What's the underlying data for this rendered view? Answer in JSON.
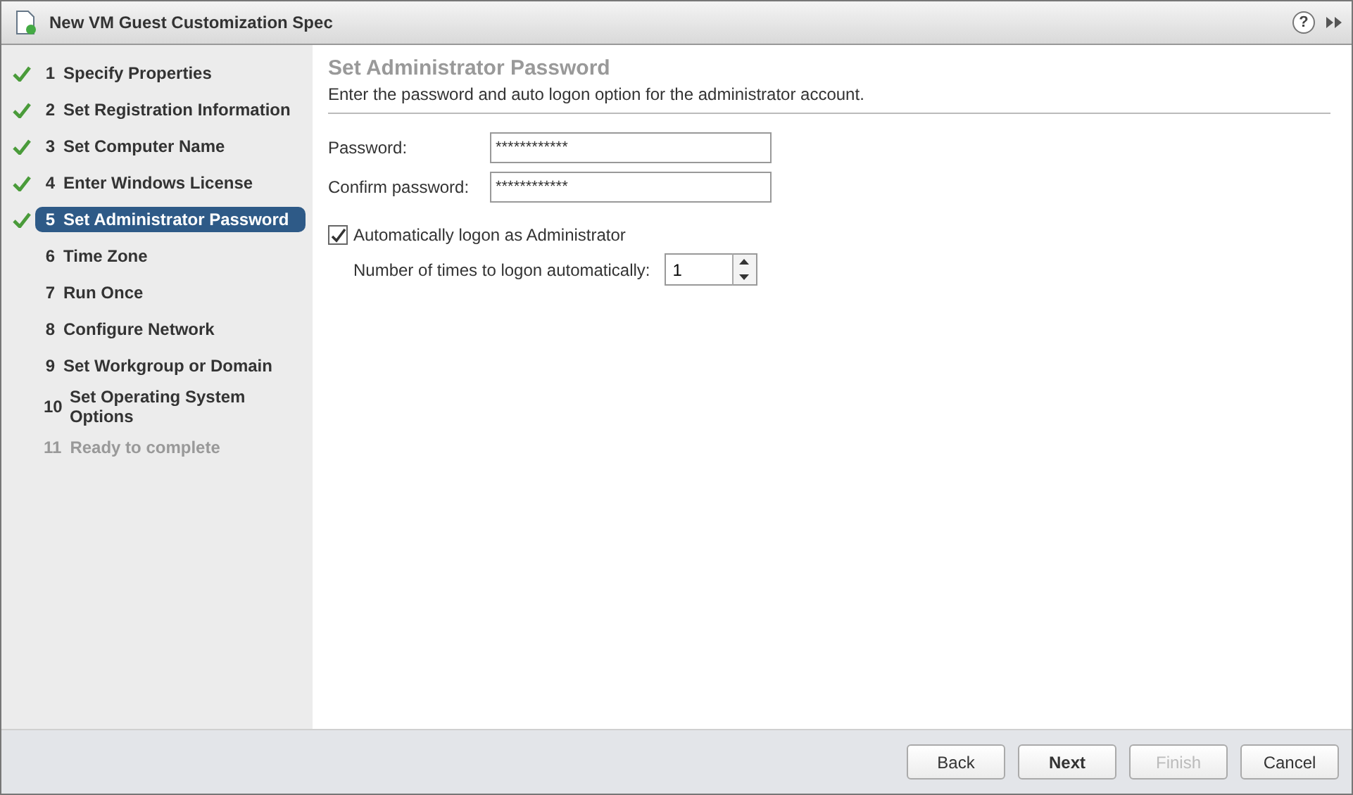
{
  "window": {
    "title": "New VM Guest Customization Spec",
    "help": "?"
  },
  "steps": [
    {
      "number": "1",
      "label": "Specify Properties",
      "done": true,
      "selected": false,
      "disabled": false
    },
    {
      "number": "2",
      "label": "Set Registration Information",
      "done": true,
      "selected": false,
      "disabled": false
    },
    {
      "number": "3",
      "label": "Set Computer Name",
      "done": true,
      "selected": false,
      "disabled": false
    },
    {
      "number": "4",
      "label": "Enter Windows License",
      "done": true,
      "selected": false,
      "disabled": false
    },
    {
      "number": "5",
      "label": "Set Administrator Password",
      "done": true,
      "selected": true,
      "disabled": false
    },
    {
      "number": "6",
      "label": "Time Zone",
      "done": false,
      "selected": false,
      "disabled": false
    },
    {
      "number": "7",
      "label": "Run Once",
      "done": false,
      "selected": false,
      "disabled": false
    },
    {
      "number": "8",
      "label": "Configure Network",
      "done": false,
      "selected": false,
      "disabled": false
    },
    {
      "number": "9",
      "label": "Set Workgroup or Domain",
      "done": false,
      "selected": false,
      "disabled": false
    },
    {
      "number": "10",
      "label": "Set Operating System Options",
      "done": false,
      "selected": false,
      "disabled": false
    },
    {
      "number": "11",
      "label": "Ready to complete",
      "done": false,
      "selected": false,
      "disabled": true
    }
  ],
  "page": {
    "title": "Set Administrator Password",
    "description": "Enter the password and auto logon option for the administrator account.",
    "fields": [
      {
        "label": "Password:",
        "value": "************"
      },
      {
        "label": "Confirm password:",
        "value": "************"
      }
    ],
    "auto_logon": {
      "label": "Automatically logon as Administrator",
      "checked": true
    },
    "logon_count": {
      "label": "Number of times to logon automatically:",
      "value": "1"
    }
  },
  "buttons": [
    {
      "label": "Back",
      "primary": false,
      "disabled": false
    },
    {
      "label": "Next",
      "primary": true,
      "disabled": false
    },
    {
      "label": "Finish",
      "primary": false,
      "disabled": true
    },
    {
      "label": "Cancel",
      "primary": false,
      "disabled": false
    }
  ]
}
